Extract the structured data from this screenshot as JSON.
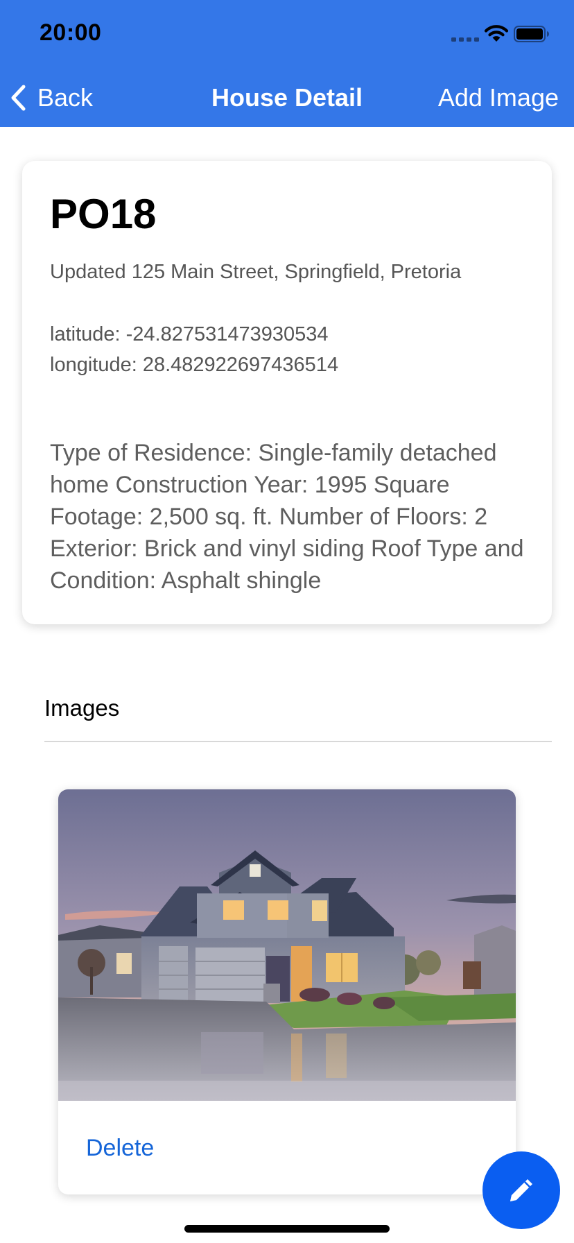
{
  "status_bar": {
    "time": "20:00"
  },
  "nav": {
    "back_label": "Back",
    "title": "House Detail",
    "add_label": "Add Image"
  },
  "house": {
    "code": "PO18",
    "address": "Updated 125 Main Street, Springfield, Pretoria",
    "latitude": "latitude: -24.827531473930534",
    "longitude": "longitude: 28.482922697436514",
    "description": "Type of Residence: Single-family detached home Construction Year: 1995 Square Footage: 2,500 sq. ft. Number of Floors: 2 Exterior: Brick and vinyl siding Roof Type and Condition: Asphalt shingle"
  },
  "images_section": {
    "heading": "Images",
    "items": [
      {
        "delete_label": "Delete"
      }
    ]
  },
  "icons": {
    "back": "chevron-left-icon",
    "fab": "pencil-icon",
    "signal": "cellular-signal-icon",
    "wifi": "wifi-icon",
    "battery": "battery-icon"
  },
  "colors": {
    "header": "#3477e8",
    "fab": "#0a5ef1",
    "link": "#1565d8"
  }
}
